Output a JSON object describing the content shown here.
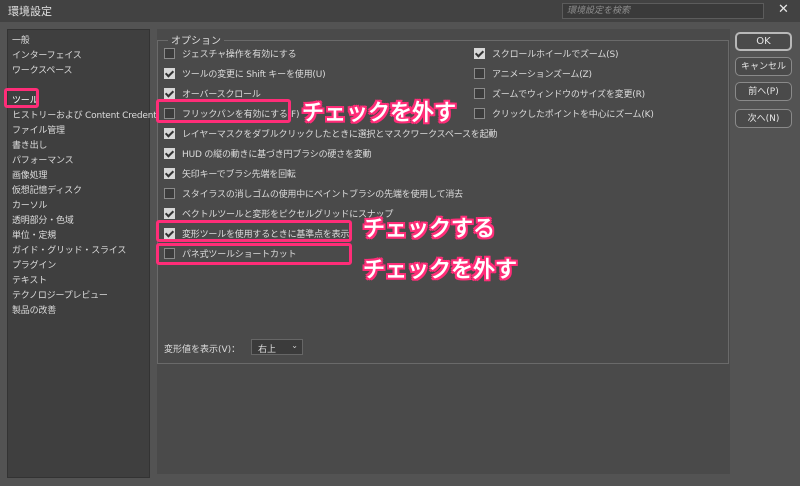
{
  "window": {
    "title": "環境設定",
    "search_placeholder": "環境設定を検索",
    "close_glyph": "✕"
  },
  "sidebar": {
    "items": [
      {
        "label": "一般",
        "selected": false
      },
      {
        "label": "インターフェイス",
        "selected": false
      },
      {
        "label": "ワークスペース",
        "selected": false
      },
      {
        "label": "ツール",
        "selected": true
      },
      {
        "label": "ヒストリーおよび Content Credentials",
        "selected": false
      },
      {
        "label": "ファイル管理",
        "selected": false
      },
      {
        "label": "書き出し",
        "selected": false
      },
      {
        "label": "パフォーマンス",
        "selected": false
      },
      {
        "label": "画像処理",
        "selected": false
      },
      {
        "label": "仮想記憶ディスク",
        "selected": false
      },
      {
        "label": "カーソル",
        "selected": false
      },
      {
        "label": "透明部分・色域",
        "selected": false
      },
      {
        "label": "単位・定規",
        "selected": false
      },
      {
        "label": "ガイド・グリッド・スライス",
        "selected": false
      },
      {
        "label": "プラグイン",
        "selected": false
      },
      {
        "label": "テキスト",
        "selected": false
      },
      {
        "label": "テクノロジープレビュー",
        "selected": false
      },
      {
        "label": "製品の改善",
        "selected": false
      }
    ]
  },
  "options": {
    "group_label": "オプション",
    "left": [
      {
        "label": "ジェスチャ操作を有効にする",
        "checked": false
      },
      {
        "label": "ツールの変更に Shift キーを使用(U)",
        "checked": true
      },
      {
        "label": "オーバースクロール",
        "checked": true
      },
      {
        "label": "フリックパンを有効にする(F)",
        "checked": false
      },
      {
        "label": "レイヤーマスクをダブルクリックしたときに選択とマスクワークスペースを起動",
        "checked": true
      },
      {
        "label": "HUD の縦の動きに基づき円ブラシの硬さを変動",
        "checked": true
      },
      {
        "label": "矢印キーでブラシ先端を回転",
        "checked": true
      },
      {
        "label": "スタイラスの消しゴムの使用中にペイントブラシの先端を使用して消去",
        "checked": false
      },
      {
        "label": "ベクトルツールと変形をピクセルグリッドにスナップ",
        "checked": true
      },
      {
        "label": "変形ツールを使用するときに基準点を表示",
        "checked": true
      },
      {
        "label": "パネ式ツールショートカット",
        "checked": false
      }
    ],
    "right": [
      {
        "label": "スクロールホイールでズーム(S)",
        "checked": true
      },
      {
        "label": "アニメーションズーム(Z)",
        "checked": false
      },
      {
        "label": "ズームでウィンドウのサイズを変更(R)",
        "checked": false
      },
      {
        "label": "クリックしたポイントを中心にズーム(K)",
        "checked": false
      }
    ],
    "transform_label": "変形値を表示(V)：",
    "transform_value": "右上"
  },
  "buttons": {
    "ok": "OK",
    "cancel": "キャンセル",
    "prev": "前へ(P)",
    "next": "次へ(N)"
  },
  "annotations": {
    "uncheck_1": "チェックを外す",
    "check": "チェックする",
    "uncheck_2": "チェックを外す",
    "color": "#ff2d78"
  }
}
